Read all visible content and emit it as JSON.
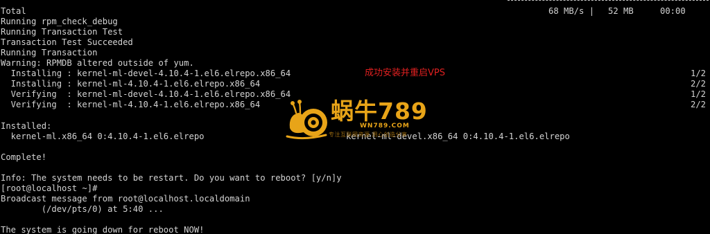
{
  "terminal": {
    "summary": {
      "label": "Total",
      "speed": "68 MB/s |",
      "size": "52 MB",
      "time": "00:00"
    },
    "lines_top": [
      "Running rpm_check_debug",
      "Running Transaction Test",
      "Transaction Test Succeeded",
      "Running Transaction",
      "Warning: RPMDB altered outside of yum."
    ],
    "transactions": [
      {
        "text": "  Installing : kernel-ml-devel-4.10.4-1.el6.elrepo.x86_64",
        "count": "1/2"
      },
      {
        "text": "  Installing : kernel-ml-4.10.4-1.el6.elrepo.x86_64",
        "count": "2/2"
      },
      {
        "text": "  Verifying  : kernel-ml-devel-4.10.4-1.el6.elrepo.x86_64",
        "count": "1/2"
      },
      {
        "text": "  Verifying  : kernel-ml-4.10.4-1.el6.elrepo.x86_64",
        "count": "2/2"
      }
    ],
    "installed_header": "Installed:",
    "installed_pkg_1": "  kernel-ml.x86_64 0:4.10.4-1.el6.elrepo",
    "installed_pkg_2": "kernel-ml-devel.x86_64 0:4.10.4-1.el6.elrepo",
    "complete": "Complete!",
    "info": "Info: The system needs to be restart. Do you want to reboot? [y/n]y",
    "prompt": "[root@localhost ~]#",
    "broadcast": "Broadcast message from root@localhost.localdomain",
    "broadcast_detail": "        (/dev/pts/0) at 5:40 ...",
    "shutdown": "The system is going down for reboot NOW!"
  },
  "annotation": "成功安装并重启VPS",
  "watermark": {
    "brand": "蜗牛789",
    "url": "WN789.COM",
    "tagline": "专注互联网资源   用心创造分享",
    "icon": "snail-logo-icon",
    "color": "#e8a418"
  }
}
